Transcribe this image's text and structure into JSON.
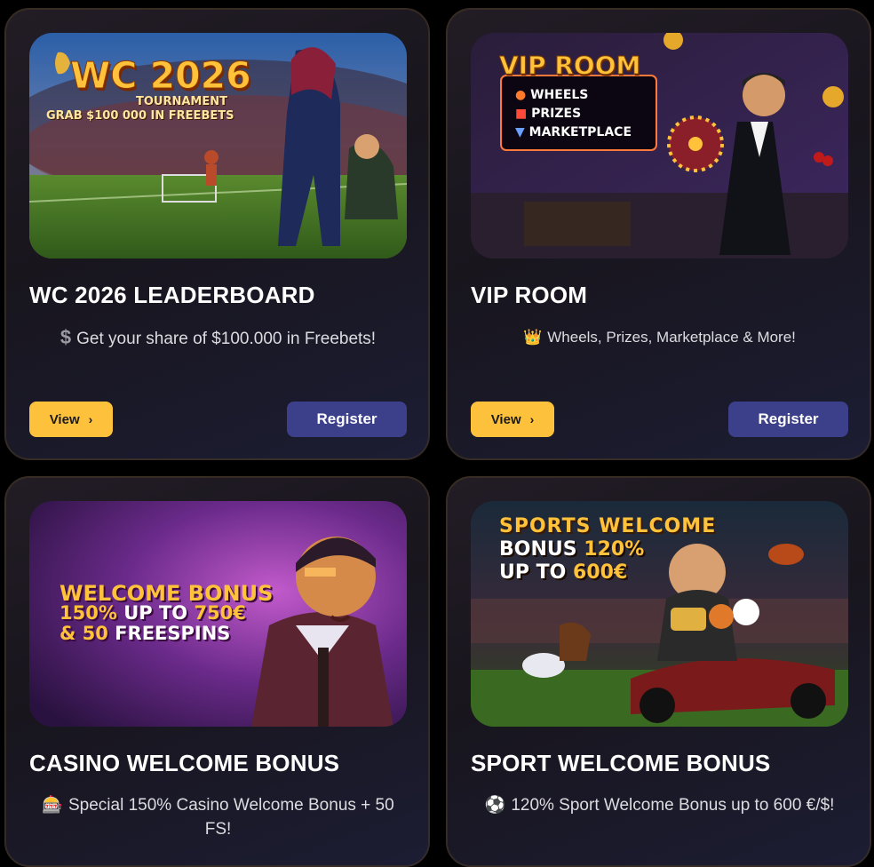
{
  "cards": [
    {
      "title": "WC 2026 LEADERBOARD",
      "icon": "dollar-icon",
      "icon_glyph": "$",
      "description": "Get your share of $100.000 in Freebets!",
      "view_label": "View",
      "register_label": "Register",
      "banner": {
        "headline": "WC 2026",
        "line1": "TOURNAMENT",
        "line2": "GRAB $100 000 IN FREEBETS"
      }
    },
    {
      "title": "VIP ROOM",
      "icon": "crown-icon",
      "icon_glyph": "👑",
      "description": "Wheels, Prizes, Marketplace & More!",
      "view_label": "View",
      "register_label": "Register",
      "banner": {
        "headline": "VIP ROOM",
        "items": [
          "WHEELS",
          "PRIZES",
          "MARKETPLACE"
        ]
      }
    },
    {
      "title": "CASINO WELCOME BONUS",
      "icon": "slot-machine-icon",
      "icon_glyph": "🎰",
      "description": "Special 150% Casino Welcome Bonus + 50 FS!",
      "banner": {
        "line1": "WELCOME BONUS",
        "line2a": "150%",
        "line2b": "UP TO",
        "line2c": "750€",
        "line3a": "& 50",
        "line3b": "FREESPINS"
      }
    },
    {
      "title": "SPORT WELCOME BONUS",
      "icon": "soccer-ball-icon",
      "icon_glyph": "⚽",
      "description": "120% Sport Welcome Bonus up to 600 €/$!",
      "banner": {
        "line1": "SPORTS WELCOME",
        "line2a": "BONUS",
        "line2b": "120%",
        "line3a": "UP TO",
        "line3b": "600€"
      }
    }
  ],
  "colors": {
    "view_button": "#fdc13c",
    "register_button": "#3c3f8a",
    "gold": "#ffc23a"
  }
}
